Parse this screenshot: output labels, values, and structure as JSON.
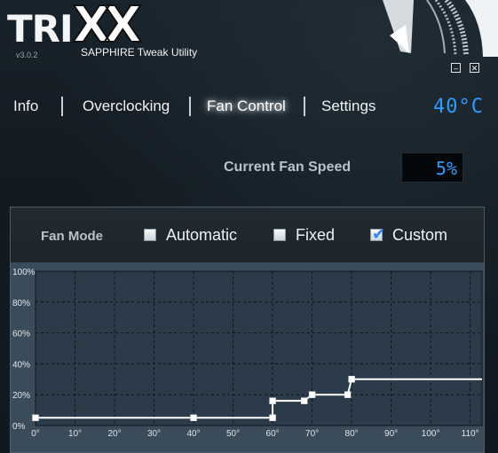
{
  "app": {
    "logo": "TRIXX",
    "logo_tri": "TRI",
    "logo_xx": "XX",
    "version": "v3.0.2",
    "subtitle": "SAPPHIRE Tweak Utility",
    "window_controls": {
      "minimize": "–",
      "close": "✕"
    }
  },
  "nav": {
    "tabs": [
      {
        "label": "Info",
        "active": false
      },
      {
        "label": "Overclocking",
        "active": false
      },
      {
        "label": "Fan Control",
        "active": true
      },
      {
        "label": "Settings",
        "active": false
      }
    ],
    "temperature": "40°C"
  },
  "fan_speed": {
    "label": "Current Fan Speed",
    "value": "5%"
  },
  "fan_mode": {
    "label": "Fan Mode",
    "options": [
      {
        "label": "Automatic",
        "checked": false
      },
      {
        "label": "Fixed",
        "checked": false
      },
      {
        "label": "Custom",
        "checked": true
      }
    ]
  },
  "colors": {
    "accent_blue": "#2f9bff",
    "plot_bg": "#2b3b4a",
    "curve": "#ffffff"
  },
  "chart_data": {
    "type": "line",
    "title": "",
    "xlabel": "",
    "ylabel": "",
    "x_ticks": [
      "0°",
      "10°",
      "20°",
      "30°",
      "40°",
      "50°",
      "60°",
      "70°",
      "80°",
      "90°",
      "100°",
      "110°"
    ],
    "y_ticks": [
      "0%",
      "20%",
      "40%",
      "60%",
      "80%",
      "100%"
    ],
    "xlim": [
      0,
      113
    ],
    "ylim": [
      0,
      100
    ],
    "grid": true,
    "series": [
      {
        "points": [
          [
            0,
            5
          ],
          [
            40,
            5
          ],
          [
            60,
            5
          ],
          [
            60,
            16
          ],
          [
            68,
            16
          ],
          [
            70,
            20
          ],
          [
            79,
            20
          ],
          [
            80,
            30
          ],
          [
            113,
            30
          ]
        ],
        "handles": [
          [
            0,
            5
          ],
          [
            40,
            5
          ],
          [
            60,
            5
          ],
          [
            60,
            16
          ],
          [
            68,
            16
          ],
          [
            70,
            20
          ],
          [
            79,
            20
          ],
          [
            80,
            30
          ]
        ]
      }
    ]
  }
}
